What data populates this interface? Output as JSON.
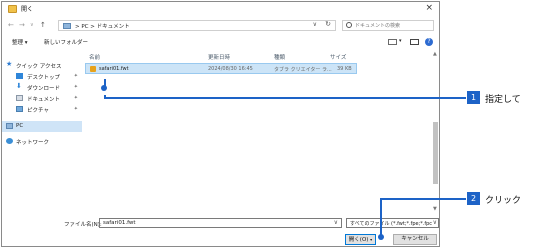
{
  "window": {
    "title": "開く",
    "close_glyph": "×"
  },
  "nav": {
    "back": "←",
    "forward": "→",
    "dropdown": "∨",
    "up": "↑",
    "address": "> PC > ドキュメント",
    "address_chevron": "∨",
    "refresh": "↻",
    "search_placeholder": "ドキュメントの検索"
  },
  "toolbar": {
    "organize": "整理 ▾",
    "new_folder": "新しいフォルダー",
    "view_menu": "▾"
  },
  "sidebar": {
    "items": [
      {
        "label": "クイック アクセス",
        "icon": "star-icon",
        "pin": ""
      },
      {
        "label": "デスクトップ",
        "icon": "desktop-icon",
        "pin": "✦"
      },
      {
        "label": "ダウンロード",
        "icon": "download-icon",
        "pin": "✦"
      },
      {
        "label": "ドキュメント",
        "icon": "documents-icon",
        "pin": "✦"
      },
      {
        "label": "ピクチャ",
        "icon": "pictures-icon",
        "pin": "✦"
      },
      {
        "label": "PC",
        "icon": "pc-icon",
        "pin": ""
      },
      {
        "label": "ネットワーク",
        "icon": "network-icon",
        "pin": ""
      }
    ]
  },
  "columns": {
    "name": "名前",
    "modified": "更新日時",
    "type": "種類",
    "size": "サイズ"
  },
  "files": [
    {
      "name": "safari01.fwt",
      "modified": "2024/08/30 16:45",
      "type": "タブラ クリエイター ラ...",
      "size": "39 KB"
    }
  ],
  "bottom": {
    "filename_label": "ファイル名(N):",
    "filename_value": "safari01.fwt",
    "filename_chevron": "∨",
    "filetype_value": "すべてのファイル (*.fwt;*.fpe;*.fpc;",
    "filetype_chevron": "∨",
    "open_label": "開く(O)",
    "open_menu": "▾",
    "cancel_label": "キャンセル"
  },
  "callouts": [
    {
      "number": "1",
      "text": "指定して"
    },
    {
      "number": "2",
      "text": "クリック"
    }
  ],
  "colors": {
    "accent": "#1d63c7",
    "selection": "#cce4f7"
  }
}
